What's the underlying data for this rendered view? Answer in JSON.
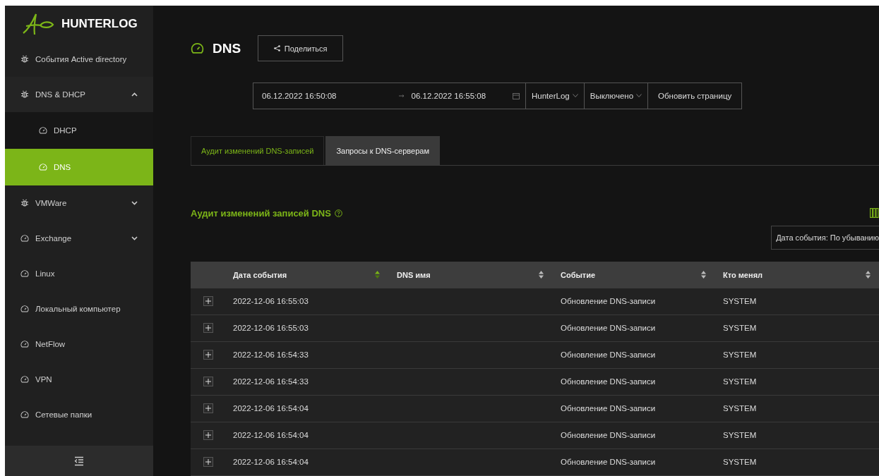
{
  "sidebar": {
    "logo": "HUNTERLOG",
    "items": [
      {
        "label": "События Active directory",
        "kind": "module",
        "selected": false
      },
      {
        "label": "DNS & DHCP",
        "kind": "module",
        "selected": false,
        "expanded": true,
        "children": [
          {
            "label": "DHCP",
            "kind": "dashboard",
            "selected": false
          },
          {
            "label": "DNS",
            "kind": "dashboard",
            "selected": true
          }
        ]
      },
      {
        "label": "VMWare",
        "kind": "module",
        "selected": false,
        "expanded": false
      },
      {
        "label": "Exchange",
        "kind": "dashboard",
        "selected": false,
        "expanded": false
      },
      {
        "label": "Linux",
        "kind": "dashboard",
        "selected": false
      },
      {
        "label": "Локальный компьютер",
        "kind": "dashboard",
        "selected": false
      },
      {
        "label": "NetFlow",
        "kind": "dashboard",
        "selected": false
      },
      {
        "label": "VPN",
        "kind": "dashboard",
        "selected": false
      },
      {
        "label": "Сетевые папки",
        "kind": "dashboard",
        "selected": false
      }
    ]
  },
  "header": {
    "title": "DNS",
    "share_button": "Поделиться"
  },
  "filters": {
    "date_from": "06.12.2022 16:50:08",
    "date_to": "06.12.2022 16:55:08",
    "source": "HunterLog",
    "mode": "Выключено",
    "refresh_button": "Обновить страницу"
  },
  "tabs": [
    {
      "label": "Аудит изменений DNS-записей",
      "selected": true
    },
    {
      "label": "Запросы к DNS-серверам",
      "selected": false
    }
  ],
  "section": {
    "title": "Аудит изменений записей DNS",
    "sort": "Дата события: По убыванию"
  },
  "table": {
    "columns": [
      {
        "label": "Дата события",
        "sorted": true
      },
      {
        "label": "DNS имя",
        "sorted": false
      },
      {
        "label": "Событие",
        "sorted": false
      },
      {
        "label": "Кто менял",
        "sorted": false
      }
    ],
    "rows": [
      {
        "date": "2022-12-06 16:55:03",
        "event": "Обновление DNS-записи",
        "who": "SYSTEM"
      },
      {
        "date": "2022-12-06 16:55:03",
        "event": "Обновление DNS-записи",
        "who": "SYSTEM"
      },
      {
        "date": "2022-12-06 16:54:33",
        "event": "Обновление DNS-записи",
        "who": "SYSTEM"
      },
      {
        "date": "2022-12-06 16:54:33",
        "event": "Обновление DNS-записи",
        "who": "SYSTEM"
      },
      {
        "date": "2022-12-06 16:54:04",
        "event": "Обновление DNS-записи",
        "who": "SYSTEM"
      },
      {
        "date": "2022-12-06 16:54:04",
        "event": "Обновление DNS-записи",
        "who": "SYSTEM"
      },
      {
        "date": "2022-12-06 16:54:04",
        "event": "Обновление DNS-записи",
        "who": "SYSTEM"
      }
    ]
  }
}
